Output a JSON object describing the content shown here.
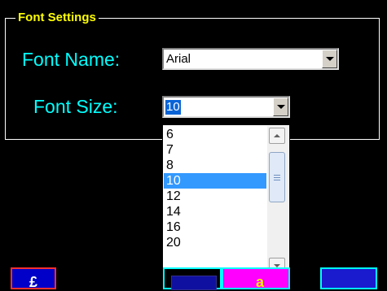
{
  "group": {
    "title": "Font Settings"
  },
  "font_name": {
    "label": "Font Name:",
    "value": "Arial"
  },
  "font_size": {
    "label": "Font Size:",
    "value": "10",
    "options": [
      "6",
      "7",
      "8",
      "10",
      "12",
      "14",
      "16",
      "20"
    ],
    "selected": "10"
  },
  "colors": {
    "background": "#000000",
    "legend": "#ffff00",
    "labels": "#00ffff",
    "selection": "#3399ff"
  },
  "icons": {
    "name_dropdown": "chevron-down-icon",
    "size_dropdown": "chevron-down-icon",
    "scroll_up": "scroll-up-icon",
    "scroll_down": "scroll-down-icon"
  }
}
